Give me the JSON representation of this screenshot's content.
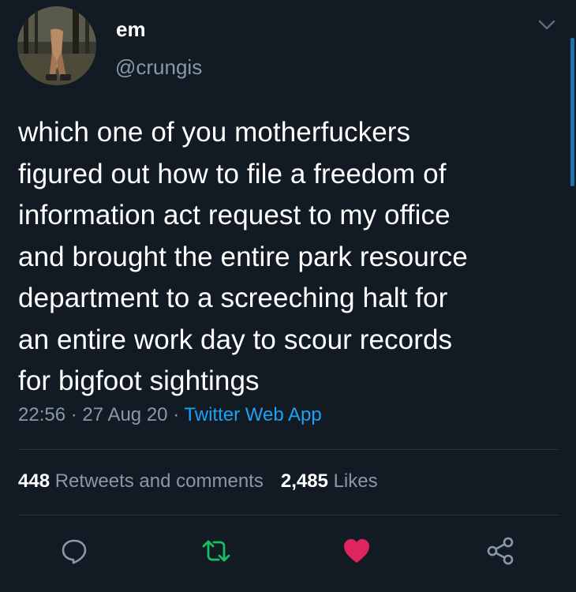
{
  "user": {
    "display_name": "em",
    "handle": "@crungis"
  },
  "tweet": {
    "text_lines": [
      "which one of you motherfuckers",
      "figured out how to file a freedom of",
      "information act request to my office",
      "and brought the entire park resource",
      "department to a screeching halt for",
      "an entire work day to scour records",
      "for bigfoot sightings"
    ],
    "time": "22:56",
    "separator": "·",
    "date": "27 Aug 20",
    "source": "Twitter Web App"
  },
  "stats": {
    "retweets_count": "448",
    "retweets_label": "Retweets and comments",
    "likes_count": "2,485",
    "likes_label": "Likes"
  },
  "colors": {
    "background": "#121b24",
    "secondary_text": "#8899a6",
    "link": "#1da1f2",
    "retweet_green": "#17bf63",
    "like_red": "#e0245e"
  },
  "icons": {
    "menu": "chevron-down-icon",
    "reply": "reply-icon",
    "retweet": "retweet-icon",
    "like": "heart-icon",
    "share": "share-icon"
  }
}
